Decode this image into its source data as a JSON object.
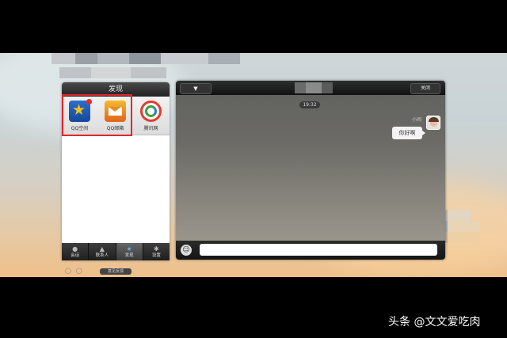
{
  "discover_panel": {
    "title": "发现",
    "apps": [
      {
        "label": "QQ空间",
        "icon": "qzone-icon"
      },
      {
        "label": "QQ邮箱",
        "icon": "qqmail-icon"
      },
      {
        "label": "腾讯网",
        "icon": "tencent-news-icon"
      }
    ],
    "tabs": [
      {
        "label": "会话",
        "icon": "chat-bubble-icon"
      },
      {
        "label": "联系人",
        "icon": "contacts-icon"
      },
      {
        "label": "发现",
        "icon": "star-icon"
      },
      {
        "label": "设置",
        "icon": "gear-icon"
      }
    ],
    "feedback_label": "意见反馈"
  },
  "chat": {
    "dropdown_glyph": "▼",
    "close_label": "关闭",
    "timestamp": "19:32",
    "sender_name": "小闹",
    "message": "你好啊",
    "input_placeholder": ""
  },
  "watermark": "头条 @文文爱吃肉",
  "colors": {
    "highlight_border": "#e0262e",
    "chat_background": "#6c6b66",
    "bubble": "#f4f4f4"
  }
}
